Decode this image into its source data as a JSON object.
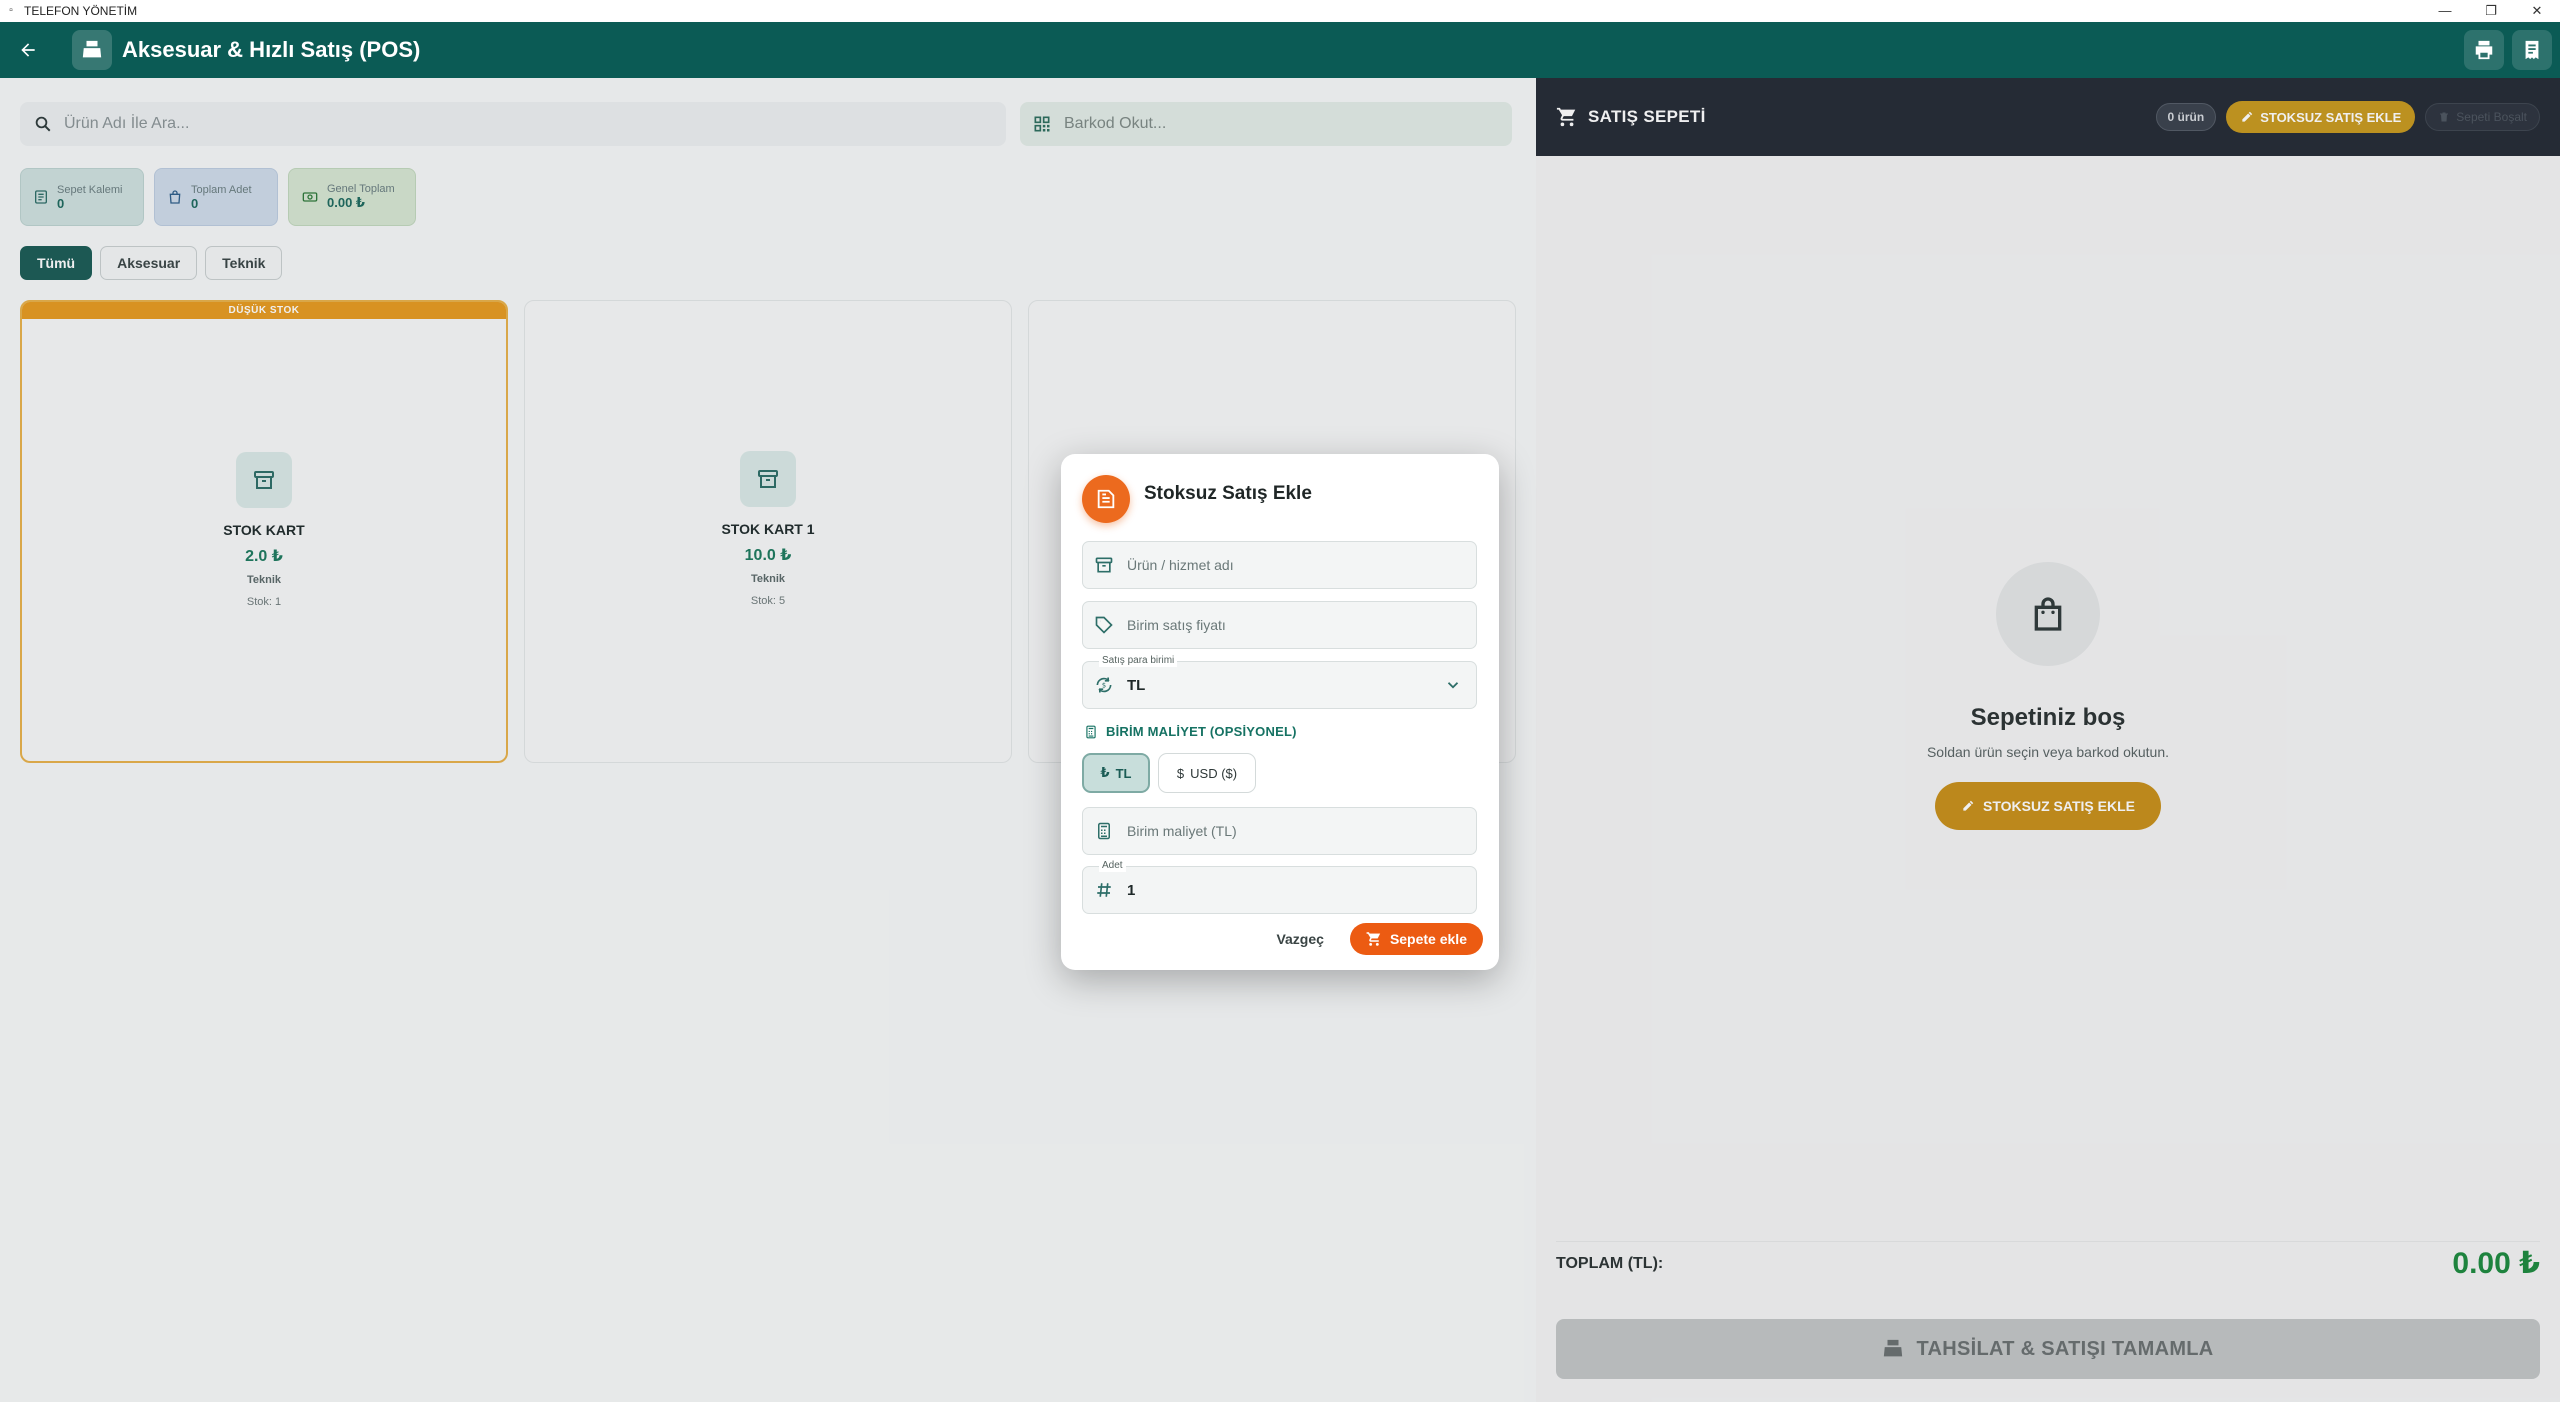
{
  "window": {
    "title": "TELEFON YÖNETİM"
  },
  "header": {
    "title": "Aksesuar & Hızlı Satış (POS)"
  },
  "search": {
    "placeholder": "Ürün Adı İle Ara...",
    "barcode_placeholder": "Barkod Okut..."
  },
  "stats": [
    {
      "label": "Sepet Kalemi",
      "value": "0"
    },
    {
      "label": "Toplam Adet",
      "value": "0"
    },
    {
      "label": "Genel Toplam",
      "value": "0.00 ₺"
    }
  ],
  "filters": [
    "Tümü",
    "Aksesuar",
    "Teknik"
  ],
  "products": [
    {
      "ribbon": "DÜŞÜK STOK",
      "name": "STOK KART",
      "price": "2.0 ₺",
      "category": "Teknik",
      "stock": "Stok: 1"
    },
    {
      "name": "STOK KART 1",
      "price": "10.0 ₺",
      "category": "Teknik",
      "stock": "Stok: 5"
    }
  ],
  "cart": {
    "title": "SATIŞ SEPETİ",
    "count": "0 ürün",
    "stoksuz_button": "STOKSUZ SATIŞ EKLE",
    "clear_button": "Sepeti Boşalt",
    "empty_title": "Sepetiniz boş",
    "empty_subtitle": "Soldan ürün seçin veya barkod okutun.",
    "empty_button": "STOKSUZ SATIŞ EKLE",
    "total_label": "TOPLAM (TL):",
    "total_value": "0.00 ₺",
    "checkout_button": "TAHSİLAT & SATIŞI TAMAMLA"
  },
  "modal": {
    "title": "Stoksuz Satış Ekle",
    "name_placeholder": "Ürün / hizmet adı",
    "price_placeholder": "Birim satış fiyatı",
    "currency_label": "Satış para birimi",
    "currency_value": "TL",
    "cost_section": "BİRİM MALİYET (OPSİYONEL)",
    "cost_tl": "TL",
    "cost_usd": "USD ($)",
    "cost_placeholder": "Birim maliyet (TL)",
    "qty_label": "Adet",
    "qty_value": "1",
    "cancel": "Vazgeç",
    "submit": "Sepete ekle"
  },
  "colors": {
    "header": "#0b5b55",
    "accent_orange": "#ec5b12",
    "gold": "#c8901a",
    "cart_header": "#242b35",
    "total_green": "#1d8a3e"
  }
}
